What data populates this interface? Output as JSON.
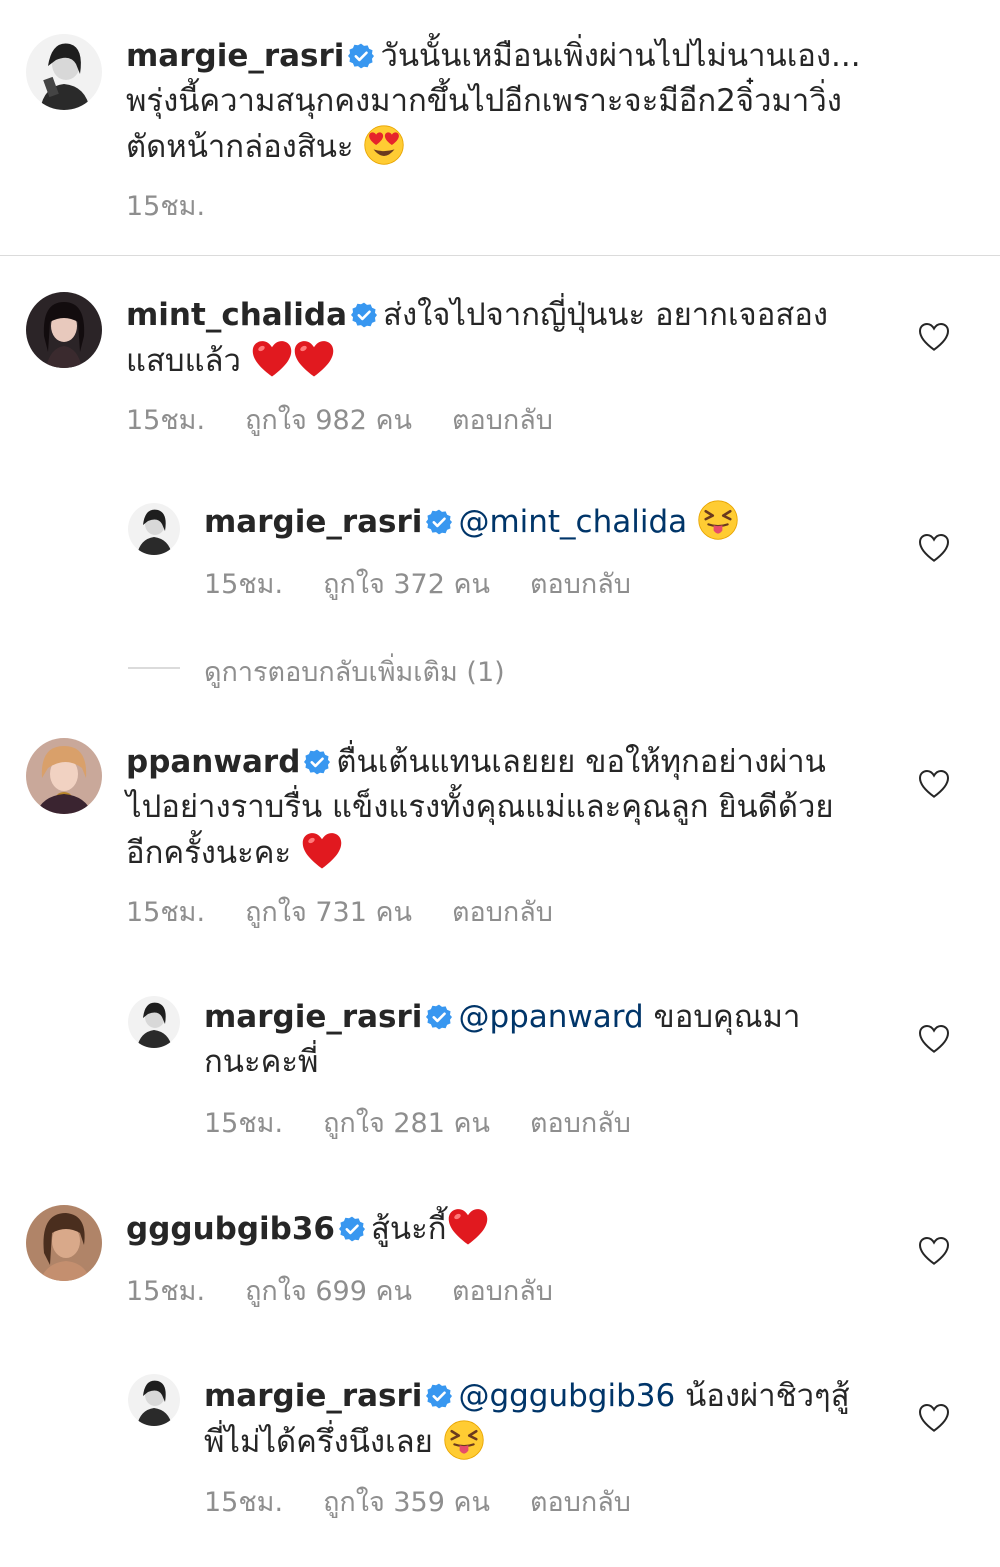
{
  "caption": {
    "username": "margie_rasri",
    "text_line1": "วันนั้นเหมือนเพิ่งผ่านไปไม่นานเอง...",
    "text_line2": "พรุ่งนี้ความสนุกคงมากขึ้นไปอีกเพราะจะมีอีก2จิ๋วมาวิ่ง",
    "text_line3": "ตัดหน้ากล่องสินะ",
    "emoji": "heart-eyes-emoji",
    "time": "15ชม."
  },
  "comments": [
    {
      "username": "mint_chalida",
      "text_line1": "ส่งใจไปจากญี่ปุ่นนะ อยากเจอสอง",
      "text_line2": "แสบแล้ว",
      "emoji": "red-heart-emoji",
      "time": "15ชม.",
      "likes": "ถูกใจ 982 คน",
      "reply": "ตอบกลับ"
    },
    {
      "username": "margie_rasri",
      "mention": "@mint_chalida",
      "emoji": "squinting-tongue-emoji",
      "time": "15ชม.",
      "likes": "ถูกใจ 372 คน",
      "reply": "ตอบกลับ"
    },
    {
      "username": "ppanward",
      "text_line1": "ตื่นเต้นแทนเลยยย ขอให้ทุกอย่างผ่าน",
      "text_line2": "ไปอย่างราบรื่น แข็งแรงทั้งคุณแม่และคุณลูก ยินดีด้วย",
      "text_line3": "อีกครั้งนะคะ",
      "emoji": "red-heart-emoji",
      "time": "15ชม.",
      "likes": "ถูกใจ 731 คน",
      "reply": "ตอบกลับ"
    },
    {
      "username": "margie_rasri",
      "mention": "@ppanward",
      "text_line1": "ขอบคุณมา",
      "text_line2": "กนะคะพี่",
      "time": "15ชม.",
      "likes": "ถูกใจ 281 คน",
      "reply": "ตอบกลับ"
    },
    {
      "username": "gggubgib36",
      "text_line1": "สู้นะกี้",
      "emoji": "red-heart-emoji",
      "time": "15ชม.",
      "likes": "ถูกใจ 699 คน",
      "reply": "ตอบกลับ"
    },
    {
      "username": "margie_rasri",
      "mention": "@gggubgib36",
      "text_line1": "น้องผ่าชิวๆสู้",
      "text_line2": "พี่ไม่ได้ครึ่งนึงเลย",
      "emoji": "squinting-tongue-emoji",
      "time": "15ชม.",
      "likes": "ถูกใจ 359 คน",
      "reply": "ตอบกลับ"
    }
  ],
  "view_more_replies": "ดูการตอบกลับเพิ่มเติม (1)",
  "colors": {
    "verified": "#3897f0",
    "mention": "#003569",
    "meta": "#8e8e8e",
    "heart_red": "#ed1c24"
  }
}
